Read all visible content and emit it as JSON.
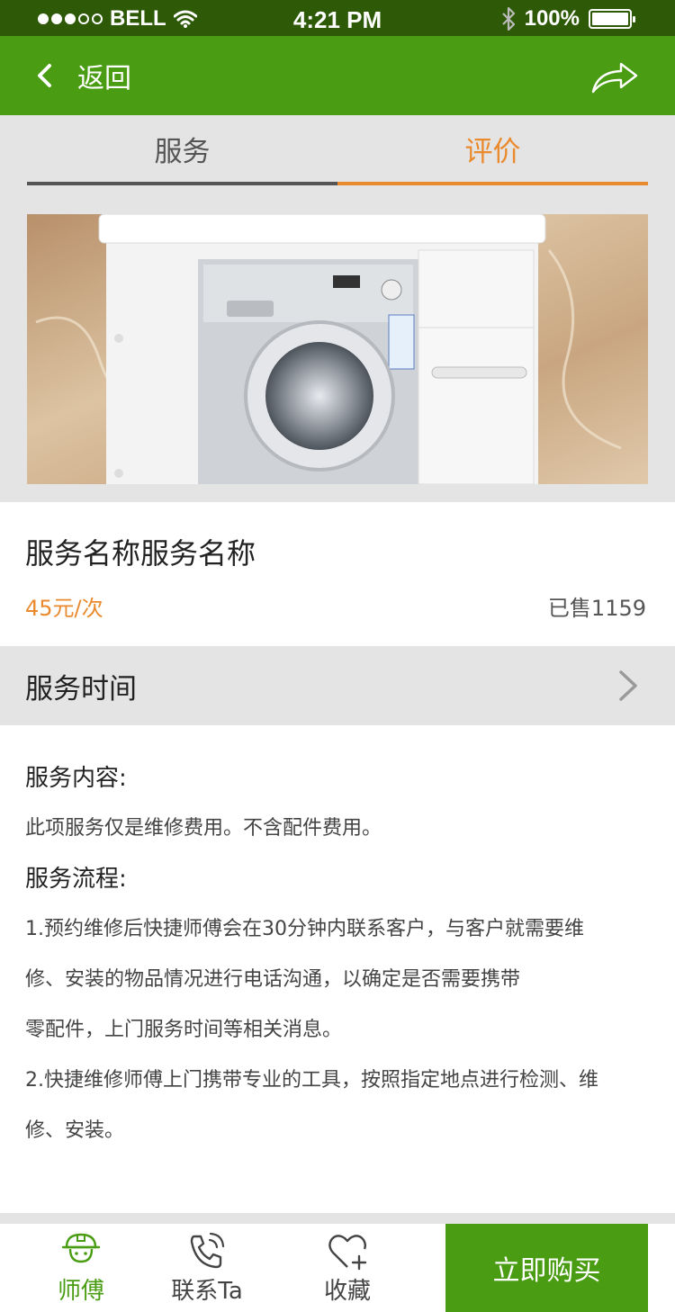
{
  "status_bar": {
    "carrier": "BELL",
    "time": "4:21 PM",
    "battery": "100%",
    "signal_bars_filled": 3,
    "signal_bars_total": 5
  },
  "nav": {
    "back_label": "返回",
    "back_icon": "chevron-left-icon",
    "share_icon": "share-icon"
  },
  "tabs": [
    {
      "label": "服务",
      "active": false
    },
    {
      "label": "评价",
      "active": true
    }
  ],
  "hero": {
    "image": "washing-machine-cabinet-photo"
  },
  "service": {
    "name": "服务名称服务名称",
    "price": "45元/次",
    "sold": "已售1159"
  },
  "service_time": {
    "label": "服务时间",
    "icon": "chevron-right-icon"
  },
  "content": {
    "content_title": "服务内容:",
    "content_text": "此项服务仅是维修费用。不含配件费用。",
    "process_title": "服务流程:",
    "process_lines": [
      "1.预约维修后快捷师傅会在30分钟内联系客户，与客户就需要维",
      "修、安装的物品情况进行电话沟通，以确定是否需要携带",
      "零配件，上门服务时间等相关消息。",
      "2.快捷维修师傅上门携带专业的工具，按照指定地点进行检测、维",
      "修、安装。"
    ]
  },
  "bottom_bar": {
    "master_label": "师傅",
    "contact_label": "联系Ta",
    "favorite_label": "收藏",
    "buy_label": "立即购买"
  },
  "colors": {
    "brand_green": "#4a9d13",
    "status_bar_green": "#2e5a07",
    "accent_orange": "#ea8a2e",
    "background_gray": "#e4e4e4"
  }
}
